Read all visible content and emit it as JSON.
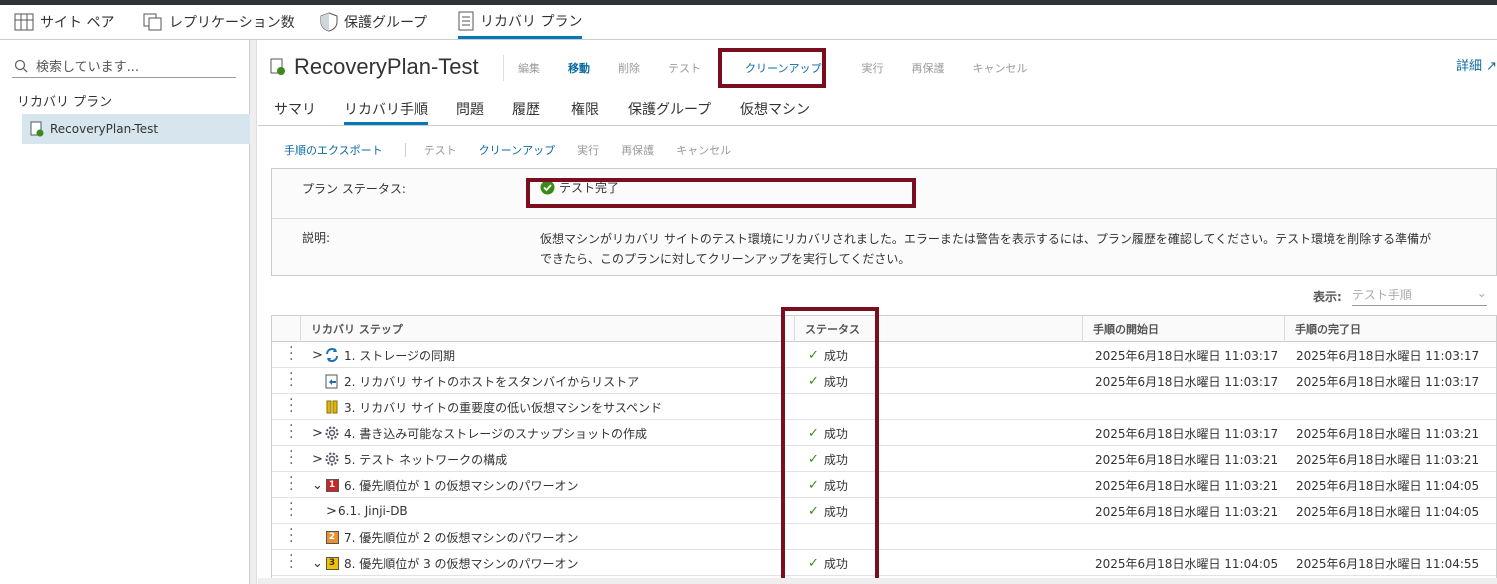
{
  "main_tabs": [
    {
      "label": "サイト ペア",
      "icon": "site-pair-icon"
    },
    {
      "label": "レプリケーション数",
      "icon": "replication-icon"
    },
    {
      "label": "保護グループ",
      "icon": "shield-icon"
    },
    {
      "label": "リカバリ プラン",
      "icon": "recovery-plan-icon"
    }
  ],
  "sidebar": {
    "search_placeholder": "検索しています...",
    "header": "リカバリ プラン",
    "items": [
      {
        "label": "RecoveryPlan-Test"
      }
    ]
  },
  "plan": {
    "title": "RecoveryPlan-Test",
    "actions": [
      "編集",
      "移動",
      "削除",
      "テスト",
      "クリーンアップ",
      "実行",
      "再保護",
      "キャンセル"
    ],
    "detail_link": "詳細"
  },
  "sub_tabs": [
    "サマリ",
    "リカバリ手順",
    "問題",
    "履歴",
    "権限",
    "保護グループ",
    "仮想マシン"
  ],
  "toolbar": [
    "手順のエクスポート",
    "テスト",
    "クリーンアップ",
    "実行",
    "再保護",
    "キャンセル"
  ],
  "info": {
    "status_label": "プラン ステータス:",
    "status_value": "テスト完了",
    "desc_label": "説明:",
    "desc_line1": "仮想マシンがリカバリ サイトのテスト環境にリカバリされました。エラーまたは警告を表示するには、プラン履歴を確認してください。テスト環境を削除する準備が",
    "desc_line2": "できたら、このプランに対してクリーンアップを実行してください。"
  },
  "view": {
    "label": "表示:",
    "value": "テスト手順"
  },
  "grid": {
    "headers": [
      "リカバリ ステップ",
      "ステータス",
      "手順の開始日",
      "手順の完了日"
    ],
    "rows": [
      {
        "step": "1. ストレージの同期",
        "status": "成功",
        "start": "2025年6月18日水曜日 11:03:17",
        "end": "2025年6月18日水曜日 11:03:17"
      },
      {
        "step": "2. リカバリ サイトのホストをスタンバイからリストア",
        "status": "成功",
        "start": "2025年6月18日水曜日 11:03:17",
        "end": "2025年6月18日水曜日 11:03:17"
      },
      {
        "step": "3. リカバリ サイトの重要度の低い仮想マシンをサスペンド",
        "status": "",
        "start": "",
        "end": ""
      },
      {
        "step": "4. 書き込み可能なストレージのスナップショットの作成",
        "status": "成功",
        "start": "2025年6月18日水曜日 11:03:17",
        "end": "2025年6月18日水曜日 11:03:21"
      },
      {
        "step": "5. テスト ネットワークの構成",
        "status": "成功",
        "start": "2025年6月18日水曜日 11:03:21",
        "end": "2025年6月18日水曜日 11:03:21"
      },
      {
        "step": "6. 優先順位が 1 の仮想マシンのパワーオン",
        "status": "成功",
        "start": "2025年6月18日水曜日 11:03:21",
        "end": "2025年6月18日水曜日 11:04:05",
        "prio": "1"
      },
      {
        "step": "6.1. Jinji-DB",
        "status": "成功",
        "start": "2025年6月18日水曜日 11:03:21",
        "end": "2025年6月18日水曜日 11:04:05"
      },
      {
        "step": "7. 優先順位が 2 の仮想マシンのパワーオン",
        "status": "",
        "start": "",
        "end": "",
        "prio": "2"
      },
      {
        "step": "8. 優先順位が 3 の仮想マシンのパワーオン",
        "status": "成功",
        "start": "2025年6月18日水曜日 11:04:05",
        "end": "2025年6月18日水曜日 11:04:55",
        "prio": "3"
      }
    ]
  },
  "colors": {
    "accent": "#0079b8",
    "highlight": "#7a0e1e",
    "success": "#3c8a1c",
    "prio1": "#c62828",
    "prio2": "#e8912d",
    "prio3": "#f2c200"
  }
}
